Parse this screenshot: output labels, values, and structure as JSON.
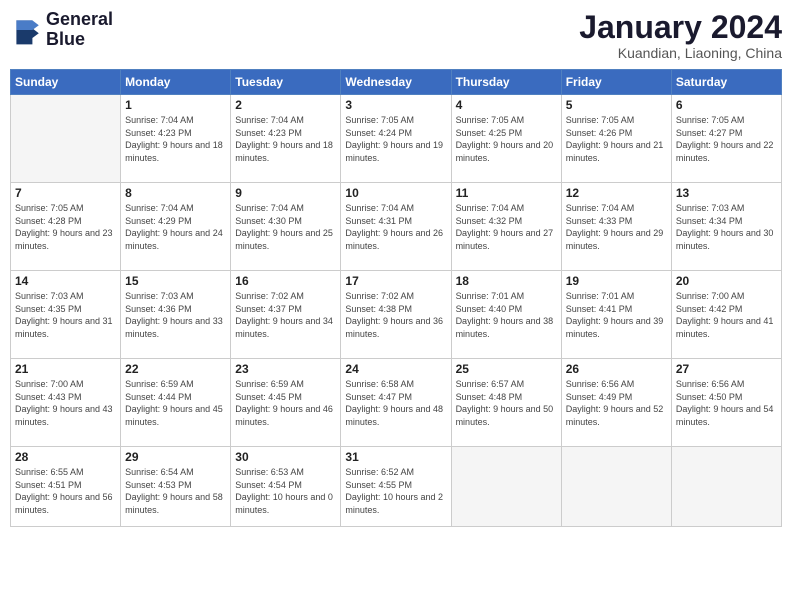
{
  "logo": {
    "name": "GeneralBlue",
    "line1": "General",
    "line2": "Blue"
  },
  "header": {
    "title": "January 2024",
    "subtitle": "Kuandian, Liaoning, China"
  },
  "days_of_week": [
    "Sunday",
    "Monday",
    "Tuesday",
    "Wednesday",
    "Thursday",
    "Friday",
    "Saturday"
  ],
  "weeks": [
    [
      {
        "day": "",
        "sunrise": "",
        "sunset": "",
        "daylight": "",
        "empty": true
      },
      {
        "day": "1",
        "sunrise": "Sunrise: 7:04 AM",
        "sunset": "Sunset: 4:23 PM",
        "daylight": "Daylight: 9 hours and 18 minutes."
      },
      {
        "day": "2",
        "sunrise": "Sunrise: 7:04 AM",
        "sunset": "Sunset: 4:23 PM",
        "daylight": "Daylight: 9 hours and 18 minutes."
      },
      {
        "day": "3",
        "sunrise": "Sunrise: 7:05 AM",
        "sunset": "Sunset: 4:24 PM",
        "daylight": "Daylight: 9 hours and 19 minutes."
      },
      {
        "day": "4",
        "sunrise": "Sunrise: 7:05 AM",
        "sunset": "Sunset: 4:25 PM",
        "daylight": "Daylight: 9 hours and 20 minutes."
      },
      {
        "day": "5",
        "sunrise": "Sunrise: 7:05 AM",
        "sunset": "Sunset: 4:26 PM",
        "daylight": "Daylight: 9 hours and 21 minutes."
      },
      {
        "day": "6",
        "sunrise": "Sunrise: 7:05 AM",
        "sunset": "Sunset: 4:27 PM",
        "daylight": "Daylight: 9 hours and 22 minutes."
      }
    ],
    [
      {
        "day": "7",
        "sunrise": "Sunrise: 7:05 AM",
        "sunset": "Sunset: 4:28 PM",
        "daylight": "Daylight: 9 hours and 23 minutes."
      },
      {
        "day": "8",
        "sunrise": "Sunrise: 7:04 AM",
        "sunset": "Sunset: 4:29 PM",
        "daylight": "Daylight: 9 hours and 24 minutes."
      },
      {
        "day": "9",
        "sunrise": "Sunrise: 7:04 AM",
        "sunset": "Sunset: 4:30 PM",
        "daylight": "Daylight: 9 hours and 25 minutes."
      },
      {
        "day": "10",
        "sunrise": "Sunrise: 7:04 AM",
        "sunset": "Sunset: 4:31 PM",
        "daylight": "Daylight: 9 hours and 26 minutes."
      },
      {
        "day": "11",
        "sunrise": "Sunrise: 7:04 AM",
        "sunset": "Sunset: 4:32 PM",
        "daylight": "Daylight: 9 hours and 27 minutes."
      },
      {
        "day": "12",
        "sunrise": "Sunrise: 7:04 AM",
        "sunset": "Sunset: 4:33 PM",
        "daylight": "Daylight: 9 hours and 29 minutes."
      },
      {
        "day": "13",
        "sunrise": "Sunrise: 7:03 AM",
        "sunset": "Sunset: 4:34 PM",
        "daylight": "Daylight: 9 hours and 30 minutes."
      }
    ],
    [
      {
        "day": "14",
        "sunrise": "Sunrise: 7:03 AM",
        "sunset": "Sunset: 4:35 PM",
        "daylight": "Daylight: 9 hours and 31 minutes."
      },
      {
        "day": "15",
        "sunrise": "Sunrise: 7:03 AM",
        "sunset": "Sunset: 4:36 PM",
        "daylight": "Daylight: 9 hours and 33 minutes."
      },
      {
        "day": "16",
        "sunrise": "Sunrise: 7:02 AM",
        "sunset": "Sunset: 4:37 PM",
        "daylight": "Daylight: 9 hours and 34 minutes."
      },
      {
        "day": "17",
        "sunrise": "Sunrise: 7:02 AM",
        "sunset": "Sunset: 4:38 PM",
        "daylight": "Daylight: 9 hours and 36 minutes."
      },
      {
        "day": "18",
        "sunrise": "Sunrise: 7:01 AM",
        "sunset": "Sunset: 4:40 PM",
        "daylight": "Daylight: 9 hours and 38 minutes."
      },
      {
        "day": "19",
        "sunrise": "Sunrise: 7:01 AM",
        "sunset": "Sunset: 4:41 PM",
        "daylight": "Daylight: 9 hours and 39 minutes."
      },
      {
        "day": "20",
        "sunrise": "Sunrise: 7:00 AM",
        "sunset": "Sunset: 4:42 PM",
        "daylight": "Daylight: 9 hours and 41 minutes."
      }
    ],
    [
      {
        "day": "21",
        "sunrise": "Sunrise: 7:00 AM",
        "sunset": "Sunset: 4:43 PM",
        "daylight": "Daylight: 9 hours and 43 minutes."
      },
      {
        "day": "22",
        "sunrise": "Sunrise: 6:59 AM",
        "sunset": "Sunset: 4:44 PM",
        "daylight": "Daylight: 9 hours and 45 minutes."
      },
      {
        "day": "23",
        "sunrise": "Sunrise: 6:59 AM",
        "sunset": "Sunset: 4:45 PM",
        "daylight": "Daylight: 9 hours and 46 minutes."
      },
      {
        "day": "24",
        "sunrise": "Sunrise: 6:58 AM",
        "sunset": "Sunset: 4:47 PM",
        "daylight": "Daylight: 9 hours and 48 minutes."
      },
      {
        "day": "25",
        "sunrise": "Sunrise: 6:57 AM",
        "sunset": "Sunset: 4:48 PM",
        "daylight": "Daylight: 9 hours and 50 minutes."
      },
      {
        "day": "26",
        "sunrise": "Sunrise: 6:56 AM",
        "sunset": "Sunset: 4:49 PM",
        "daylight": "Daylight: 9 hours and 52 minutes."
      },
      {
        "day": "27",
        "sunrise": "Sunrise: 6:56 AM",
        "sunset": "Sunset: 4:50 PM",
        "daylight": "Daylight: 9 hours and 54 minutes."
      }
    ],
    [
      {
        "day": "28",
        "sunrise": "Sunrise: 6:55 AM",
        "sunset": "Sunset: 4:51 PM",
        "daylight": "Daylight: 9 hours and 56 minutes."
      },
      {
        "day": "29",
        "sunrise": "Sunrise: 6:54 AM",
        "sunset": "Sunset: 4:53 PM",
        "daylight": "Daylight: 9 hours and 58 minutes."
      },
      {
        "day": "30",
        "sunrise": "Sunrise: 6:53 AM",
        "sunset": "Sunset: 4:54 PM",
        "daylight": "Daylight: 10 hours and 0 minutes."
      },
      {
        "day": "31",
        "sunrise": "Sunrise: 6:52 AM",
        "sunset": "Sunset: 4:55 PM",
        "daylight": "Daylight: 10 hours and 2 minutes."
      },
      {
        "day": "",
        "sunrise": "",
        "sunset": "",
        "daylight": "",
        "empty": true
      },
      {
        "day": "",
        "sunrise": "",
        "sunset": "",
        "daylight": "",
        "empty": true
      },
      {
        "day": "",
        "sunrise": "",
        "sunset": "",
        "daylight": "",
        "empty": true
      }
    ]
  ]
}
